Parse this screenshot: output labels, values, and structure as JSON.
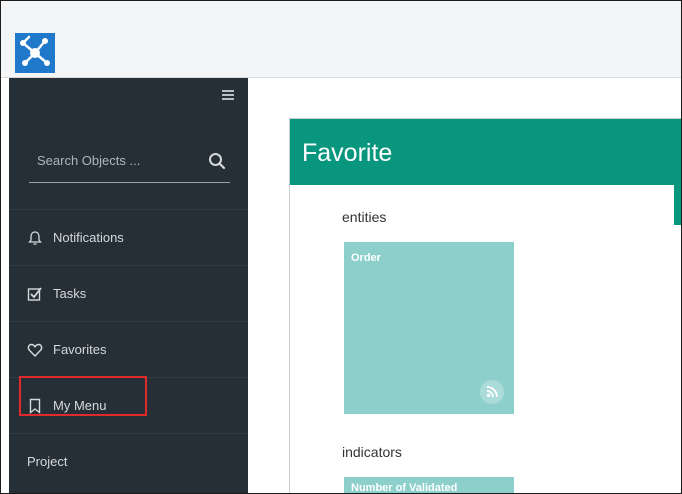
{
  "topbar": {
    "logo_icon": "network-logo-icon",
    "brand_color": "#1f78c9"
  },
  "sidebar": {
    "menu_icon": "hamburger-icon",
    "search": {
      "placeholder": "Search Objects ...",
      "value": "",
      "icon": "search-icon"
    },
    "items": [
      {
        "label": "Notifications",
        "icon": "bell-icon"
      },
      {
        "label": "Tasks",
        "icon": "checkbox-icon"
      },
      {
        "label": "Favorites",
        "icon": "heart-icon"
      },
      {
        "label": "My Menu",
        "icon": "bookmark-icon",
        "highlighted": true
      },
      {
        "label": "Project"
      }
    ],
    "highlight_color": "#e12b2b"
  },
  "main": {
    "panel_title": "Favorite",
    "header_color": "#08967f",
    "sections": [
      {
        "title": "entities",
        "tiles": [
          {
            "label": "Order",
            "icon": "rss-icon",
            "color": "#8ccfcb"
          }
        ]
      },
      {
        "title": "indicators",
        "tiles": [
          {
            "label": "Number of Validated",
            "color": "#8ccfcb"
          }
        ]
      }
    ]
  }
}
